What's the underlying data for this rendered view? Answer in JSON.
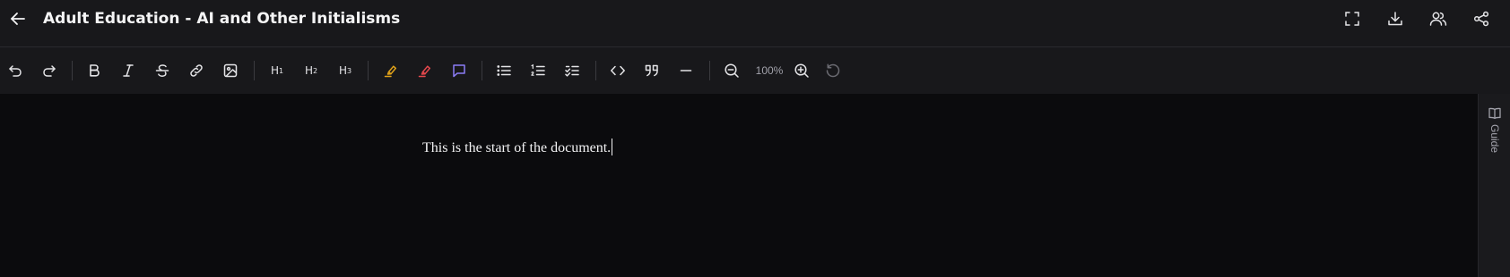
{
  "header": {
    "title": "Adult Education - AI and Other Initialisms",
    "actions": [
      "fullscreen",
      "download",
      "collaborators",
      "share"
    ]
  },
  "toolbar": {
    "h1": "H",
    "h1_sub": "1",
    "h2": "H",
    "h2_sub": "2",
    "h3": "H",
    "h3_sub": "3",
    "zoom": "100%",
    "colors": {
      "highlight_yellow": "#e0a21a",
      "highlight_red": "#e5484d",
      "comment_purple": "#8b7cf6"
    }
  },
  "document": {
    "text": "This is the start of the document."
  },
  "side_panel": {
    "guide_label": "Guide"
  }
}
